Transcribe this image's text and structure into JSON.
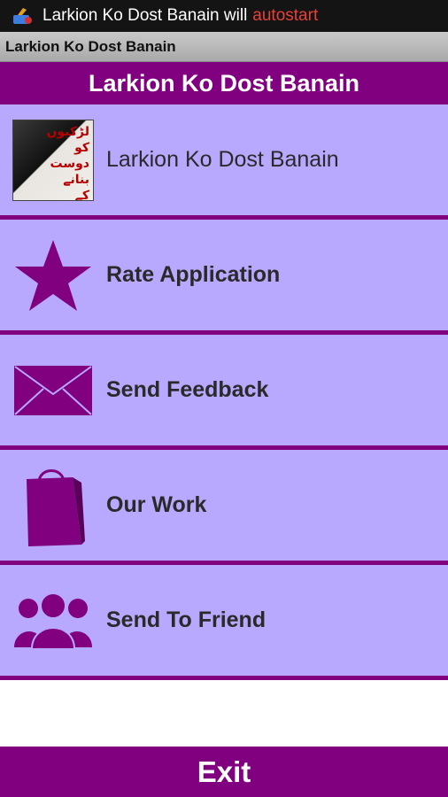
{
  "status_bar": {
    "notification_text": "Larkion Ko Dost Banain will",
    "notification_warning": "autostart",
    "icon": "broom-icon"
  },
  "title_bar": {
    "title": "Larkion Ko Dost Banain"
  },
  "header": {
    "title": "Larkion Ko Dost Banain"
  },
  "menu": {
    "items": [
      {
        "label": "Larkion Ko Dost Banain",
        "icon": "app-thumbnail",
        "thumb_text": "لڑکیوں کو دوست بنانے کے طریقے"
      },
      {
        "label": "Rate Application",
        "icon": "star-icon"
      },
      {
        "label": "Send Feedback",
        "icon": "envelope-icon"
      },
      {
        "label": "Our Work",
        "icon": "shopping-bag-icon"
      },
      {
        "label": "Send To Friend",
        "icon": "people-icon"
      }
    ]
  },
  "footer": {
    "exit_label": "Exit"
  },
  "colors": {
    "accent": "#800080",
    "item_bg": "#b8a9ff",
    "status_bg": "#141414",
    "warning": "#e8403a"
  }
}
